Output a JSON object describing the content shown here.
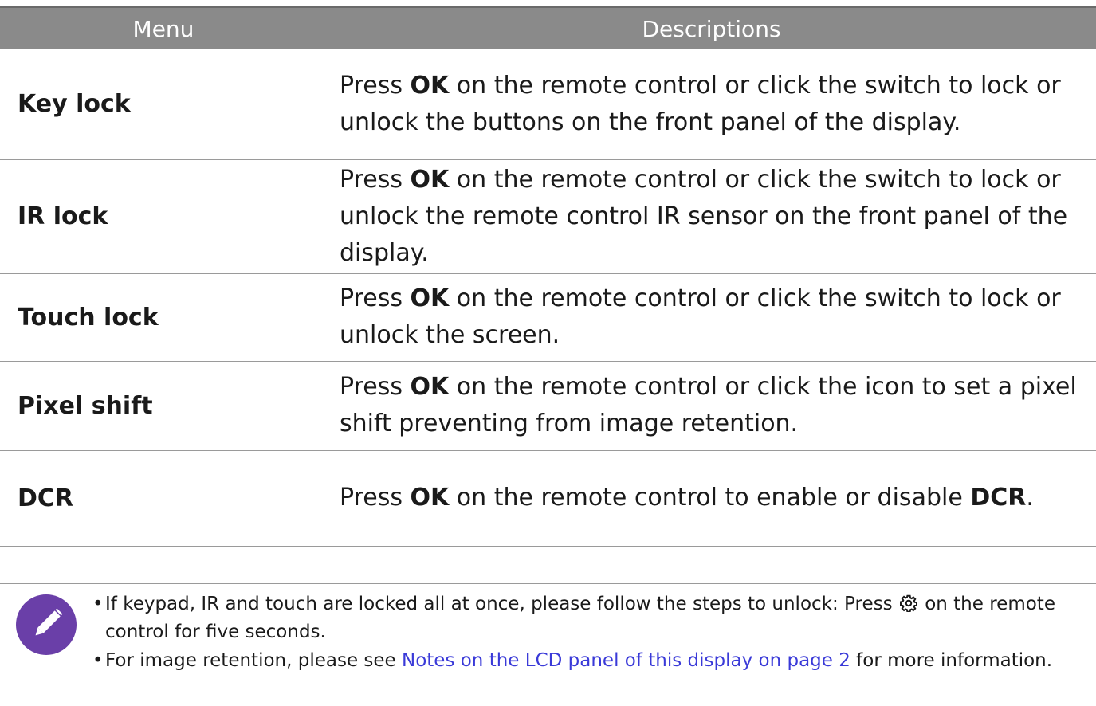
{
  "table": {
    "header": {
      "menu": "Menu",
      "descriptions": "Descriptions"
    },
    "rows": [
      {
        "menu": "Key lock",
        "desc": {
          "before": "Press ",
          "bold": "OK",
          "after": " on the remote control or click the switch to lock or unlock the buttons on the front panel of the display."
        }
      },
      {
        "menu": "IR lock",
        "desc": {
          "before": "Press ",
          "bold": "OK",
          "after": " on the remote control or click the switch to lock or unlock the remote control IR sensor on the front panel of the display."
        }
      },
      {
        "menu": "Touch lock",
        "desc": {
          "before": "Press ",
          "bold": "OK",
          "after": " on the remote control or click the switch to lock or unlock the screen."
        }
      },
      {
        "menu": "Pixel shift",
        "desc": {
          "before": "Press ",
          "bold": "OK",
          "after": " on the remote control or click the icon to set a pixel shift preventing from image retention."
        }
      },
      {
        "menu": "DCR",
        "desc": {
          "before": "Press ",
          "bold": "OK",
          "middle": " on the remote control to enable or disable ",
          "bold2": "DCR",
          "after": "."
        }
      }
    ]
  },
  "notes": {
    "icon": "pencil-icon",
    "bullet": "•",
    "item1": {
      "before": "If keypad, IR and touch are locked all at once, please follow the steps to unlock: Press ",
      "icon": "gear-icon",
      "after": " on the remote control for five seconds."
    },
    "item2": {
      "before": "For image retention, please see ",
      "link": "Notes on the LCD panel of this display on page 2",
      "after": " for more information."
    }
  },
  "colors": {
    "header_bg": "#8a8a8a",
    "icon_bg": "#6a3fa8",
    "link": "#3a3ad8"
  }
}
